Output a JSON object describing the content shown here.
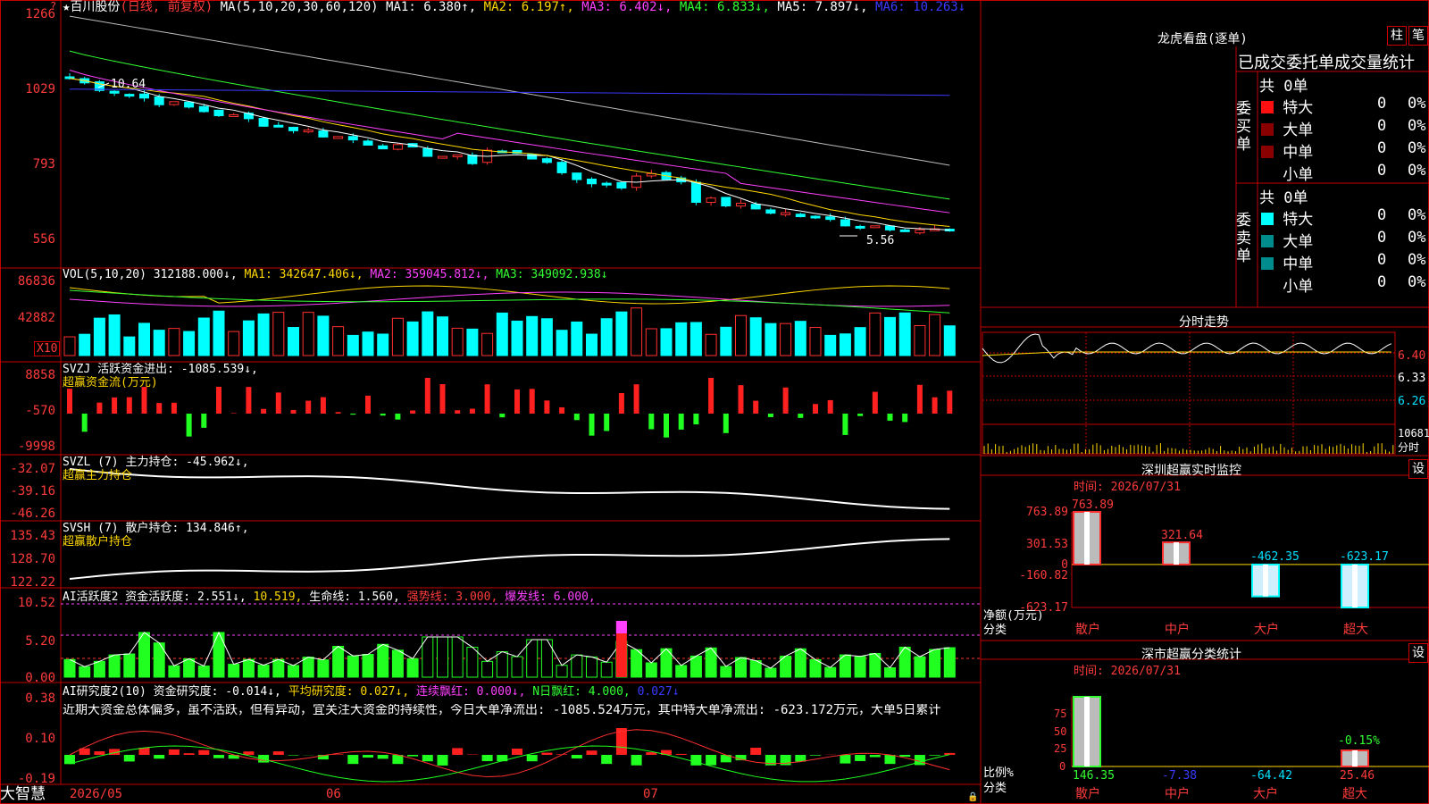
{
  "window": {
    "brand": "大智慧",
    "corner_mark": "?"
  },
  "main": {
    "star": "★",
    "stock": "百川股份",
    "mode": "(日线, 前复权)",
    "ma_label": "MA(5,10,20,30,60,120)",
    "ma1": "MA1: 6.380↑,",
    "ma2": "MA2: 6.197↑,",
    "ma3": "MA3: 6.402↓,",
    "ma4": "MA4: 6.833↓,",
    "ma5": "MA5: 7.897↓,",
    "ma6": "MA6: 10.263↓",
    "y_ticks": [
      "1266",
      "1029",
      "793",
      "556"
    ],
    "hi_label": "10.64",
    "lo_label": "5.56"
  },
  "vol": {
    "label": "VOL(5,10,20)",
    "v": "312188.000↓,",
    "ma1": "MA1: 342647.406↓,",
    "ma2": "MA2: 359045.812↓,",
    "ma3": "MA3: 349092.938↓",
    "y_ticks": [
      "86836",
      "42882"
    ],
    "unit": "X10"
  },
  "svzj": {
    "label": "SVZJ  活跃资金进出: -1085.539↓,",
    "sub": "超赢资金流(万元)",
    "y_ticks": [
      "8858",
      "-570",
      "-9998"
    ]
  },
  "svzl": {
    "label": "SVZL (7) 主力持仓: -45.962↓,",
    "sub": "超赢主力持仓",
    "y_ticks": [
      "-32.07",
      "-39.16",
      "-46.26"
    ]
  },
  "svsh": {
    "label": "SVSH (7) 散户持仓: 134.846↑,",
    "sub": "超赢散户持仓",
    "y_ticks": [
      "135.43",
      "128.70",
      "122.22"
    ]
  },
  "ai_act": {
    "label": "AI活跃度2 资金活跃度: 2.551↓,",
    "v2": "10.519,",
    "v3": "生命线: 1.560,",
    "v4": "强势线: 3.000,",
    "v5": "爆发线: 6.000,",
    "y_ticks": [
      "10.52",
      "5.20",
      "0.00"
    ]
  },
  "ai_res": {
    "label": "AI研究度2(10) 资金研究度: -0.014↓,",
    "v2": "平均研究度: 0.027↓,",
    "v3": "连续飘红: 0.000↓,",
    "v4": "N日飘红: 4.000,",
    "v5": "0.027↓",
    "text": "近期大资金总体偏多，虽不活跃，但有异动，宜关注大资金的持续性，今日大单净流出: -1085.524万元，其中特大单净流出: -623.172万元，大单5日累计",
    "y_ticks": [
      "0.38",
      "0.10",
      "-0.19"
    ]
  },
  "dates": [
    "2026/05",
    "06",
    "07"
  ],
  "lhb": {
    "title": "龙虎看盘(逐单)",
    "btn1": "柱",
    "btn2": "笔",
    "header": "已成交委托单成交量统计",
    "buy_side": "委买单",
    "sell_side": "委卖单",
    "buy_total": "共 0单",
    "sell_total": "共 0单",
    "buy_rows": [
      {
        "name": "特大",
        "n": "0",
        "p": "0%"
      },
      {
        "name": "大单",
        "n": "0",
        "p": "0%"
      },
      {
        "name": "中单",
        "n": "0",
        "p": "0%"
      },
      {
        "name": "小单",
        "n": "0",
        "p": "0%"
      }
    ],
    "sell_rows": [
      {
        "name": "特大",
        "n": "0",
        "p": "0%"
      },
      {
        "name": "大单",
        "n": "0",
        "p": "0%"
      },
      {
        "name": "中单",
        "n": "0",
        "p": "0%"
      },
      {
        "name": "小单",
        "n": "0",
        "p": "0%"
      }
    ],
    "colors": {
      "buy": [
        "#ff1010",
        "#8a0000",
        "#8a0000",
        "#000000"
      ],
      "sell": [
        "#00ffff",
        "#008c8c",
        "#008c8c",
        "#000000"
      ]
    }
  },
  "intraday": {
    "title": "分时走势",
    "y_ticks": [
      "6.40",
      "6.33",
      "6.26"
    ],
    "vol_label": "10681",
    "vol_sub": "分时"
  },
  "sz_monitor": {
    "title": "深圳超赢实时监控",
    "btn": "设",
    "time": "时间: 2026/07/31",
    "y_ticks": [
      "763.89",
      "301.53",
      "0",
      "-160.82",
      "-623.17"
    ],
    "ylabel": "净额(万元)",
    "xlabel": "分类",
    "categories": [
      "散户",
      "中户",
      "大户",
      "超大"
    ],
    "values": [
      763.89,
      321.64,
      -462.35,
      -623.17
    ],
    "value_labels": [
      "763.89",
      "321.64",
      "-462.35",
      "-623.17"
    ]
  },
  "sz_class": {
    "title": "深市超赢分类统计",
    "btn": "设",
    "time": "时间: 2026/07/31",
    "y_ticks": [
      "75",
      "50",
      "25",
      "0"
    ],
    "ylabel": "比例%",
    "xlabel": "分类",
    "categories": [
      "散户",
      "中户",
      "大户",
      "超大"
    ],
    "values": [
      "146.35",
      "-7.38",
      "-64.42",
      "25.46"
    ],
    "note": "-0.15%"
  },
  "chart_data": [
    {
      "type": "candlestick",
      "title": "百川股份 (日线, 前复权)",
      "y_ticks": [
        "1266",
        "1029",
        "793",
        "556"
      ],
      "annotations": [
        "10.64",
        "5.56"
      ],
      "series_names": [
        "MA1",
        "MA2",
        "MA3",
        "MA4",
        "MA5",
        "MA6"
      ]
    },
    {
      "type": "bar",
      "title": "VOL(5,10,20)",
      "y_ticks": [
        "86836",
        "42882"
      ]
    },
    {
      "type": "bar",
      "title": "SVZJ",
      "y_ticks": [
        "8858",
        "-570",
        "-9998"
      ]
    },
    {
      "type": "line",
      "title": "SVZL",
      "y_ticks": [
        "-32.07",
        "-39.16",
        "-46.26"
      ]
    },
    {
      "type": "line",
      "title": "SVSH",
      "y_ticks": [
        "135.43",
        "128.70",
        "122.22"
      ]
    },
    {
      "type": "bar",
      "title": "AI活跃度2",
      "y_ticks": [
        "10.52",
        "5.20",
        "0.00"
      ]
    },
    {
      "type": "bar",
      "title": "AI研究度2(10)",
      "y_ticks": [
        "0.38",
        "0.10",
        "-0.19"
      ]
    },
    {
      "type": "bar",
      "title": "深圳超赢实时监控",
      "categories": [
        "散户",
        "中户",
        "大户",
        "超大"
      ],
      "values": [
        763.89,
        321.64,
        -462.35,
        -623.17
      ]
    }
  ]
}
